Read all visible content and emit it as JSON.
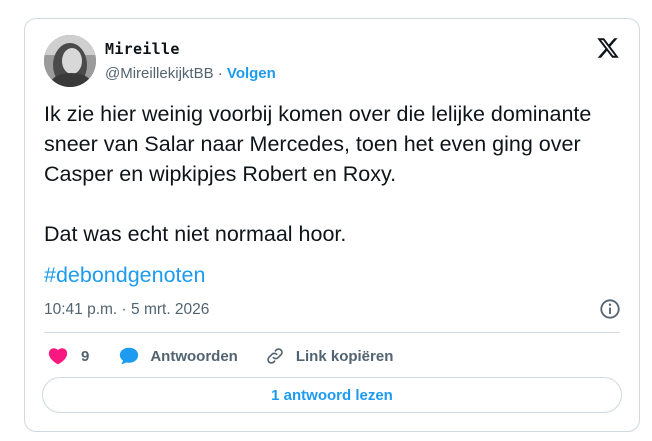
{
  "author": {
    "name": "Mireille",
    "handle": "@MireillekijktBB",
    "separator": "·",
    "follow_label": "Volgen"
  },
  "post": {
    "paragraph_1": "Ik zie hier weinig voorbij komen over die lelijke dominante sneer van Salar naar Mercedes, toen het even ging over Casper en wipkipjes Robert en Roxy.",
    "paragraph_2": "Dat was echt niet normaal hoor.",
    "hashtag": "#debondgenoten",
    "timestamp": "10:41 p.m. · 5 mrt. 2026"
  },
  "actions": {
    "like_count": "9",
    "reply_label": "Antwoorden",
    "copy_link_label": "Link kopiëren"
  },
  "read_replies_label": "1 antwoord lezen",
  "icons": {
    "logo": "x-logo-icon",
    "info": "info-icon",
    "like": "heart-icon",
    "reply": "speech-bubble-icon",
    "copy": "link-icon"
  },
  "colors": {
    "accent": "#1d9bf0",
    "like": "#f91880",
    "text": "#0f1419",
    "muted": "#536471",
    "border": "#cfd9de"
  }
}
